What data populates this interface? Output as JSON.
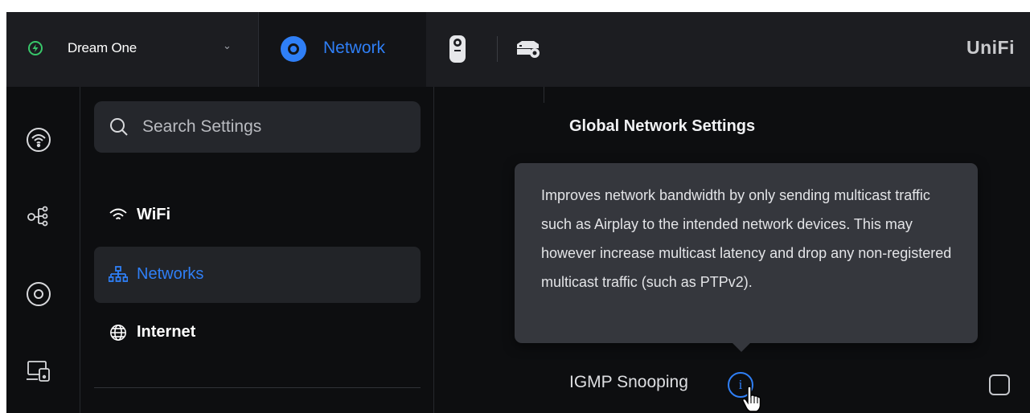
{
  "topbar": {
    "console_name": "Dream One",
    "console_chevron": "⌄",
    "app_network_label": "Network",
    "brand": "UniFi"
  },
  "rail": {
    "items": [
      "wifi-icon",
      "topology-icon",
      "target-icon",
      "devices-icon"
    ]
  },
  "settings_nav": {
    "search_placeholder": "Search Settings",
    "items": [
      {
        "label": "WiFi",
        "icon": "wifi-icon",
        "active": false
      },
      {
        "label": "Networks",
        "icon": "network-tree-icon",
        "active": true
      },
      {
        "label": "Internet",
        "icon": "globe-icon",
        "active": false
      }
    ]
  },
  "content": {
    "section_title": "Global Network Settings",
    "tooltip_text": "Improves network bandwidth by only sending multicast traffic such as Airplay to the intended network devices. This may however increase multicast latency and drop any non-registered multicast traffic (such as PTPv2).",
    "setting_label": "IGMP Snooping",
    "info_glyph": "i",
    "checkbox_checked": false
  },
  "colors": {
    "accent": "#2f7ff6",
    "status_online": "#38c76a",
    "background": "#0d0e10",
    "tooltip_bg": "#35373d"
  }
}
